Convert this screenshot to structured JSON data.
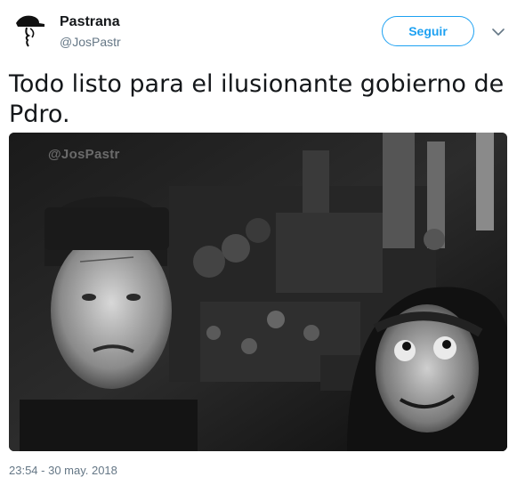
{
  "user": {
    "display_name": "Pastrana",
    "handle": "@JosPastr",
    "avatar_icon": "hat-figure-avatar"
  },
  "actions": {
    "follow_label": "Seguir",
    "more_icon": "chevron-down-icon"
  },
  "tweet": {
    "text": "Todo listo para el ilusionante gobierno de Pdro.",
    "timestamp": "23:54 - 30 may. 2018"
  },
  "media": {
    "watermark": "@JosPastr"
  },
  "colors": {
    "accent": "#1da1f2",
    "text_primary": "#14171a",
    "text_secondary": "#657786"
  }
}
